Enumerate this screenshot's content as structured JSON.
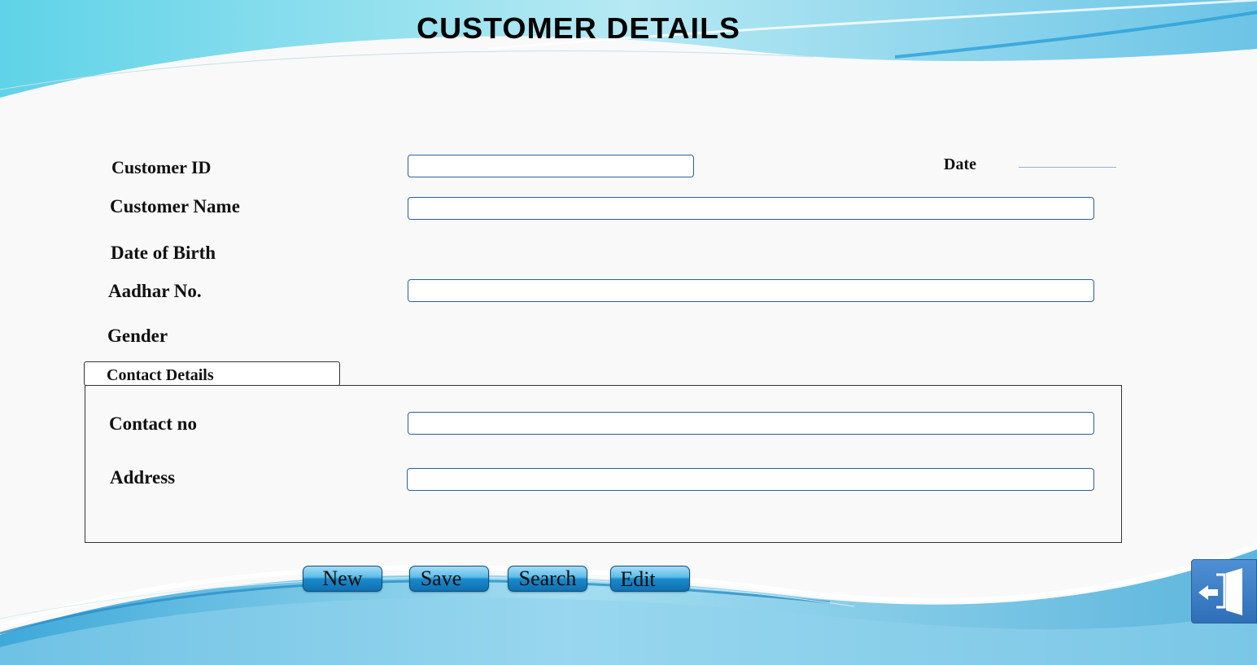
{
  "page": {
    "title": "CUSTOMER DETAILS"
  },
  "form": {
    "customer_id": {
      "label": "Customer ID",
      "value": ""
    },
    "date": {
      "label": "Date",
      "value": ""
    },
    "customer_name": {
      "label": "Customer Name",
      "value": ""
    },
    "date_of_birth": {
      "label": "Date of Birth"
    },
    "aadhar_no": {
      "label": "Aadhar No.",
      "value": ""
    },
    "gender": {
      "label": "Gender"
    }
  },
  "contact": {
    "group_label": "Contact Details",
    "contact_no": {
      "label": "Contact no",
      "value": ""
    },
    "address": {
      "label": "Address",
      "value": ""
    }
  },
  "buttons": {
    "new": "New",
    "save": "Save",
    "search": "Search",
    "edit": "Edit",
    "exit_icon": "exit-door-icon"
  },
  "colors": {
    "accent_blue": "#1a8acb",
    "field_border": "#2d5f9c",
    "wave_light": "#a8e4f0"
  }
}
